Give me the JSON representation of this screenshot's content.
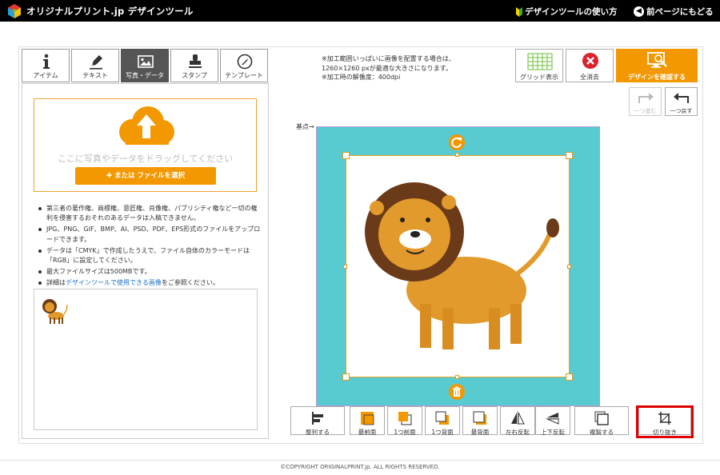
{
  "header": {
    "brand": "オリジナルプリント.jp デザインツール",
    "howto_link": "デザインツールの使い方",
    "back_link": "前ページにもどる"
  },
  "tabs": [
    {
      "label": "アイテム",
      "icon": "info-icon"
    },
    {
      "label": "テキスト",
      "icon": "pen-icon"
    },
    {
      "label": "写真・データ",
      "icon": "image-icon",
      "active": true
    },
    {
      "label": "スタンプ",
      "icon": "stamp-icon"
    },
    {
      "label": "テンプレート",
      "icon": "template-icon"
    }
  ],
  "upload": {
    "drop_text": "ここに写真やデータをドラッグしてください",
    "select_button": "または ファイルを選択"
  },
  "notes": [
    "第三者の著作権、商標権、意匠権、肖像権、パブリシティ権など一切の権利を侵害するおそれのあるデータは入稿できません。",
    "JPG、PNG、GIF、BMP、AI、PSD、PDF、EPS形式のファイルをアップロードできます。",
    "データは「CMYK」で作成したうえで、ファイル自体のカラーモードは「RGB」に設定してください。",
    "最大ファイルサイズは500MBです。"
  ],
  "notes_last": {
    "prefix": "詳細は",
    "link": "デザインツールで使用できる画像",
    "suffix": "をご参照ください。"
  },
  "info": {
    "line1": "※加工範囲いっぱいに画像を配置する場合は、",
    "line2": "1260×1260 pxが最適な大きさになります。",
    "line3": "※加工時の解像度：400dpi"
  },
  "toolbar": {
    "grid": "グリッド表示",
    "clear": "全消去",
    "confirm": "デザインを確認する",
    "redo": "一つ進む",
    "undo": "一つ戻す"
  },
  "canvas": {
    "origin_label": "基点→"
  },
  "bottom_tools": [
    "整列する",
    "最前面",
    "1つ前面",
    "1つ背面",
    "最背面",
    "左右反転",
    "上下反転",
    "複製する",
    "切り抜き"
  ],
  "colors": {
    "accent": "#f39800",
    "canvas": "#58cbd0",
    "highlight": "#e10000"
  },
  "footer": {
    "copyright": "©COPYRIGHT ORIGINALPRINT.jp. ALL RIGHTS RESERVED."
  }
}
